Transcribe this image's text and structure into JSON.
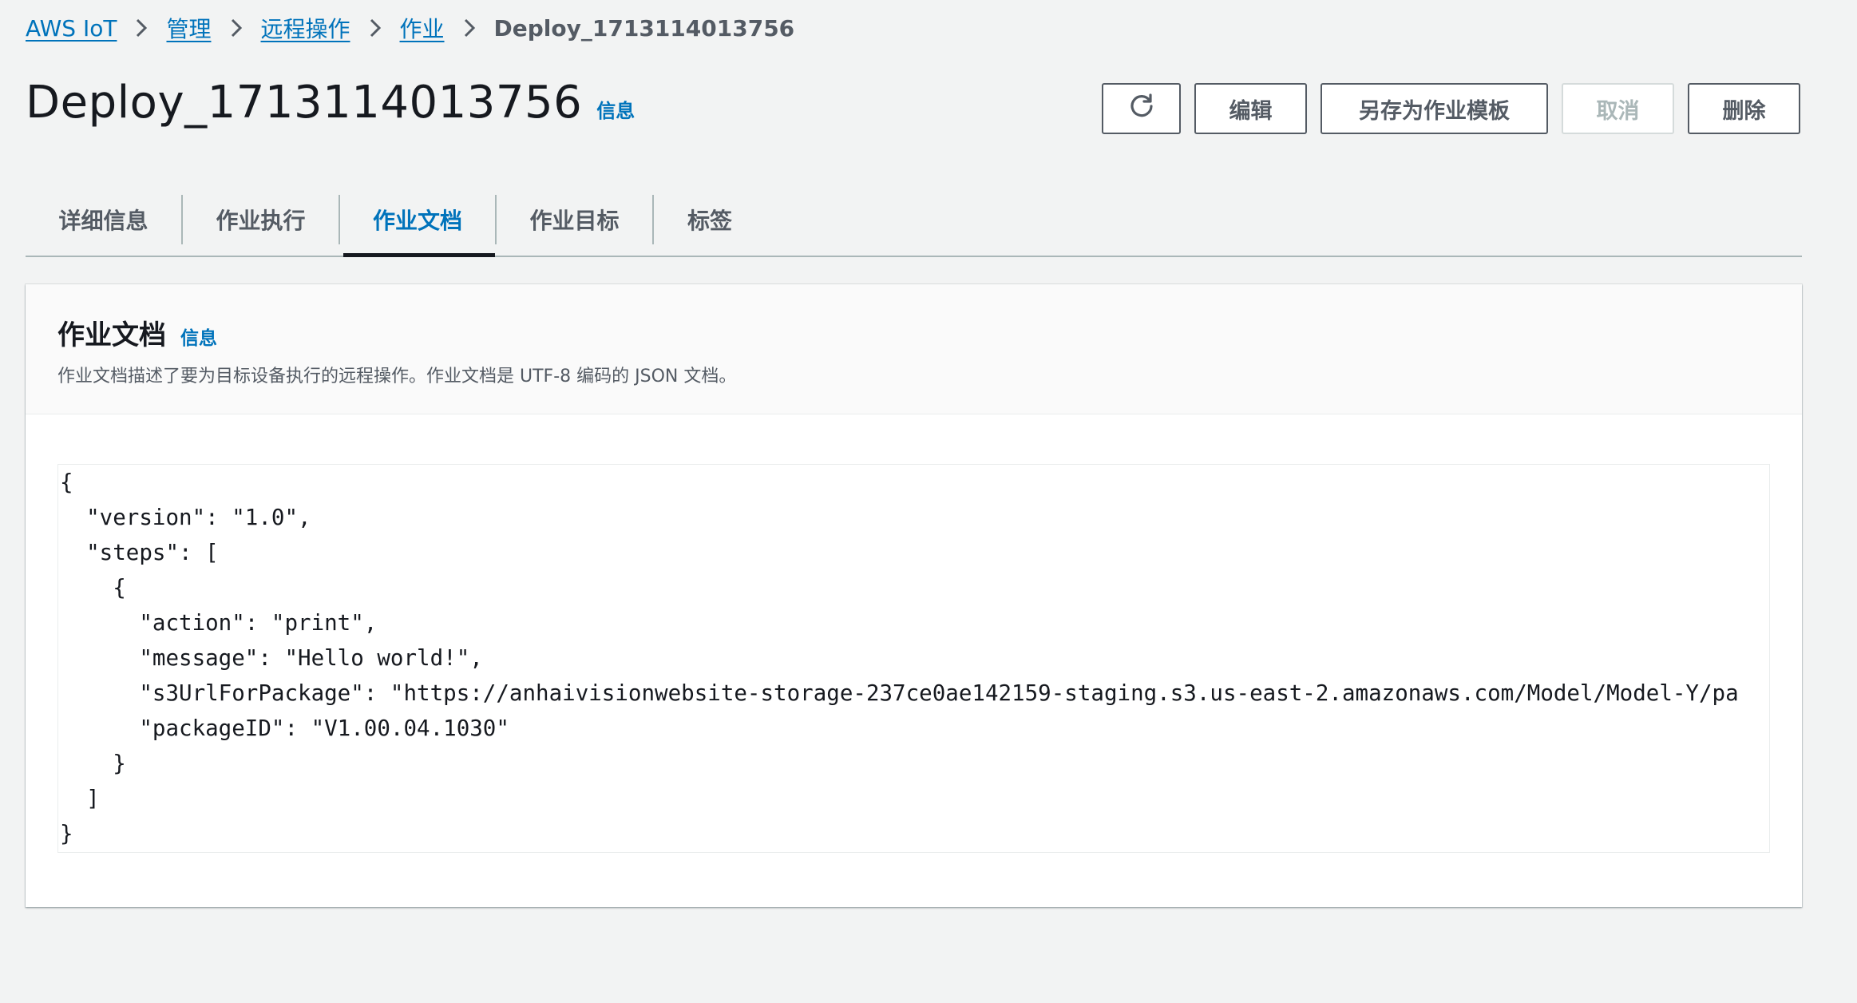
{
  "breadcrumb": {
    "items": [
      "AWS IoT",
      "管理",
      "远程操作",
      "作业"
    ],
    "current": "Deploy_1713114013756"
  },
  "header": {
    "title": "Deploy_1713114013756",
    "info_label": "信息"
  },
  "actions": {
    "refresh_icon": "refresh-icon",
    "edit_label": "编辑",
    "save_template_label": "另存为作业模板",
    "cancel_label": "取消",
    "delete_label": "删除"
  },
  "tabs": [
    {
      "label": "详细信息",
      "active": false
    },
    {
      "label": "作业执行",
      "active": false
    },
    {
      "label": "作业文档",
      "active": true
    },
    {
      "label": "作业目标",
      "active": false
    },
    {
      "label": "标签",
      "active": false
    }
  ],
  "job_document": {
    "title": "作业文档",
    "info_label": "信息",
    "description": "作业文档描述了要为目标设备执行的远程操作。作业文档是 UTF-8 编码的 JSON 文档。",
    "code": "{\n  \"version\": \"1.0\",\n  \"steps\": [\n    {\n      \"action\": \"print\",\n      \"message\": \"Hello world!\",\n      \"s3UrlForPackage\": \"https://anhaivisionwebsite-storage-237ce0ae142159-staging.s3.us-east-2.amazonaws.com/Model/Model-Y/pa\n      \"packageID\": \"V1.00.04.1030\"\n    }\n  ]\n}"
  },
  "colors": {
    "link": "#0073bb",
    "text": "#16191f",
    "muted": "#545b64",
    "background": "#f2f3f3"
  }
}
